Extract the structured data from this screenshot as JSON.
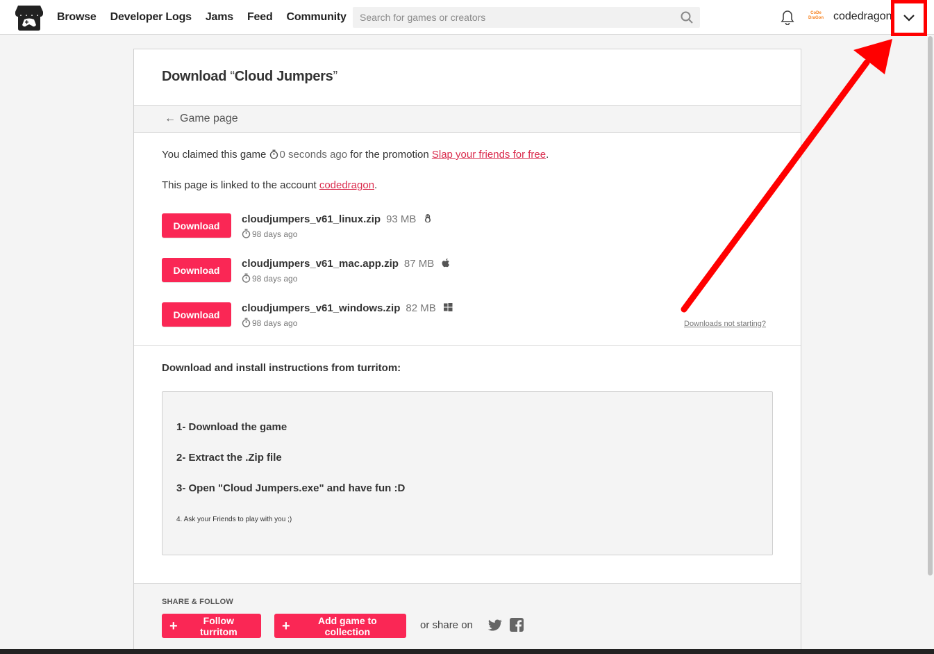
{
  "header": {
    "nav": [
      "Browse",
      "Developer Logs",
      "Jams",
      "Feed",
      "Community"
    ],
    "search_placeholder": "Search for games or creators",
    "avatar_text": "CoDe DraGon",
    "username": "codedragon"
  },
  "page": {
    "title_prefix": "Download ",
    "title_open_quote": "“",
    "game_name": "Cloud Jumpers",
    "title_close_quote": "”",
    "back_arrow": "←",
    "game_page_link": "Game page",
    "claim_text": "You claimed this game ",
    "claim_time": "0 seconds ago",
    "claim_mid": " for the promotion ",
    "promotion_link": "Slap your friends for free",
    "claim_end": ".",
    "linked_text": "This page is linked to the account ",
    "linked_account": "codedragon",
    "linked_end": ".",
    "downloads_not_starting": "Downloads not starting?"
  },
  "downloads": [
    {
      "button": "Download",
      "file": "cloudjumpers_v61_linux.zip",
      "size": "93 MB",
      "os_icon": "linux-icon",
      "date": "98 days ago"
    },
    {
      "button": "Download",
      "file": "cloudjumpers_v61_mac.app.zip",
      "size": "87 MB",
      "os_icon": "apple-icon",
      "date": "98 days ago"
    },
    {
      "button": "Download",
      "file": "cloudjumpers_v61_windows.zip",
      "size": "82 MB",
      "os_icon": "windows-icon",
      "date": "98 days ago"
    }
  ],
  "instructions": {
    "title": "Download and install instructions from turritom:",
    "steps": [
      "1- Download the game",
      "2- Extract the .Zip file",
      "3- Open \"Cloud Jumpers.exe\" and have fun :D"
    ],
    "small_step": "4. Ask your Friends to play with you ;)"
  },
  "footer": {
    "share_title": "SHARE & FOLLOW",
    "follow_button": "Follow turritom",
    "collection_button": "Add game to collection",
    "share_on": "or share on",
    "plus_glyph": "+"
  },
  "colors": {
    "accent": "#fa2755",
    "link": "#da2c4d",
    "annotation": "#ff0000"
  }
}
